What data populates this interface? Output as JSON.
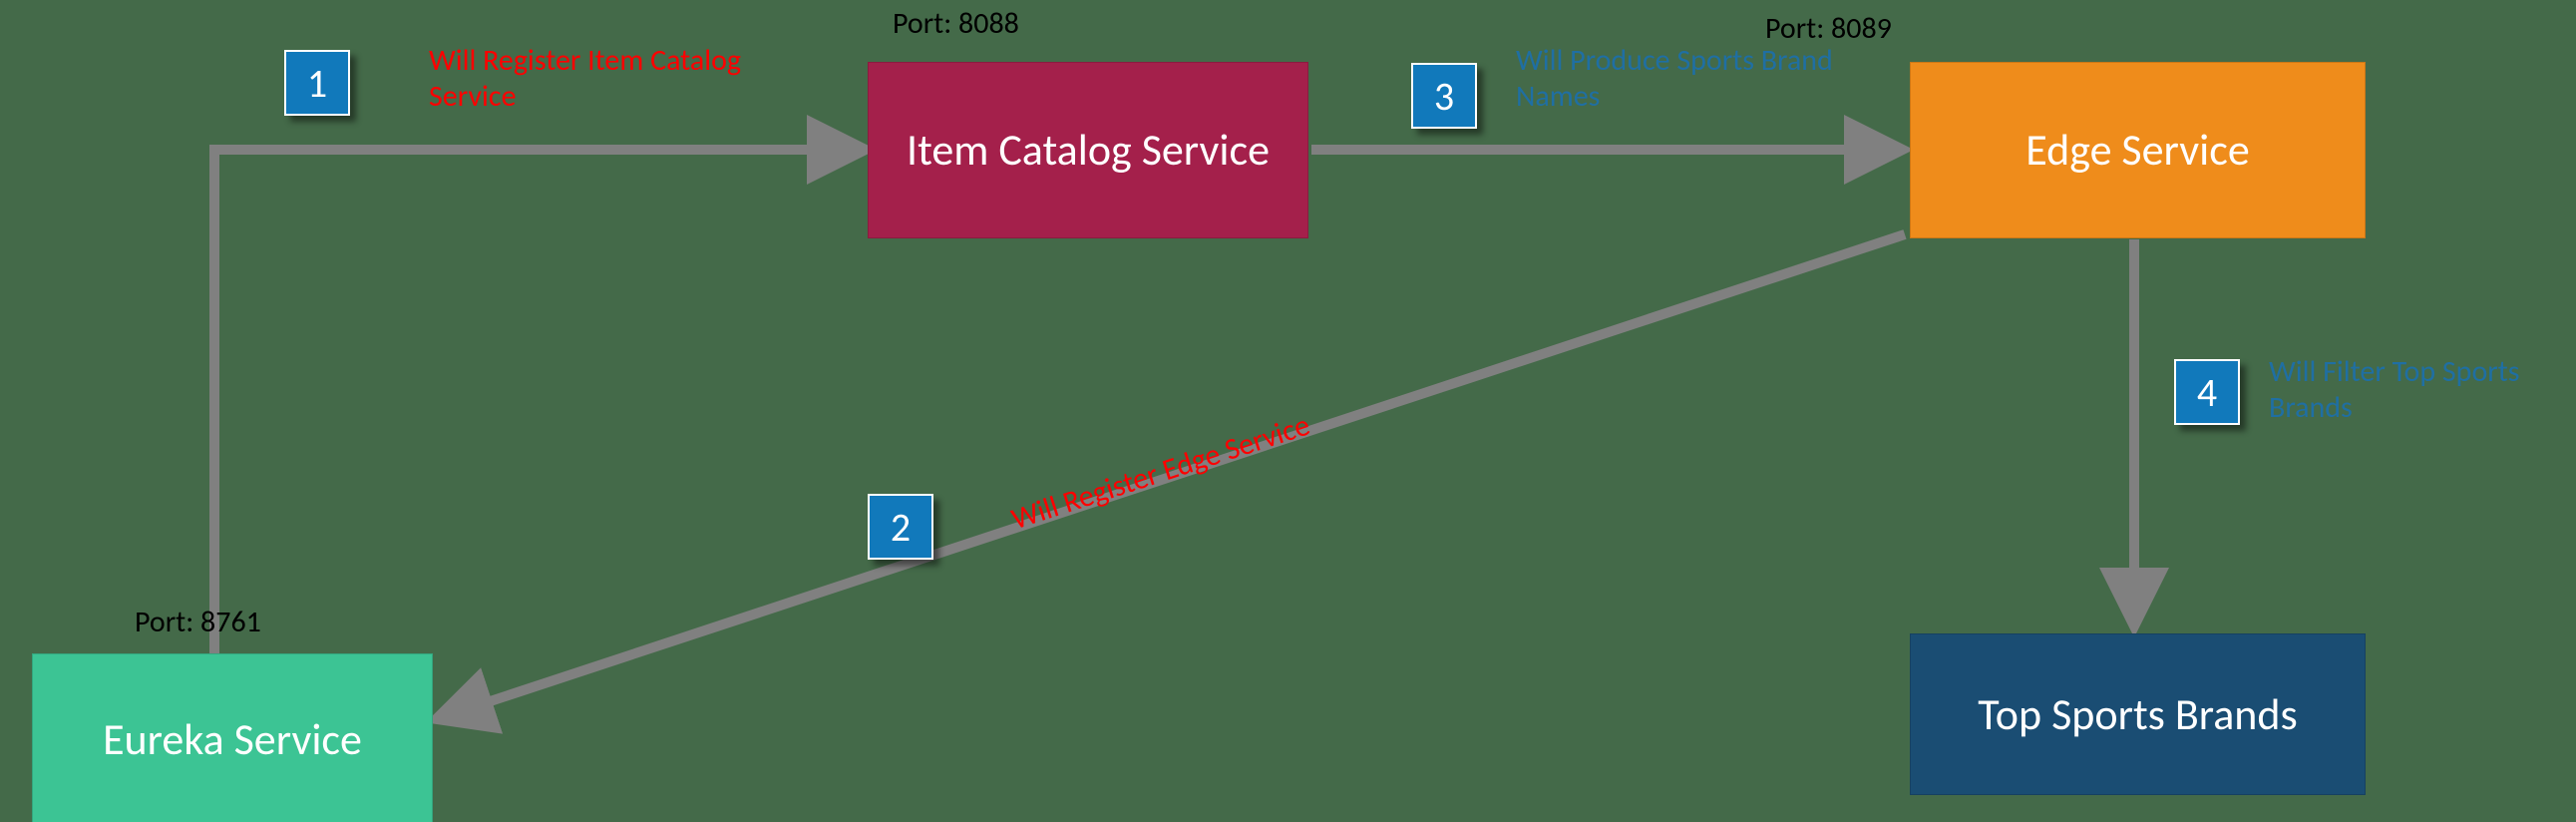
{
  "services": {
    "eureka": {
      "label": "Eureka Service",
      "port_label": "Port: 8761"
    },
    "itemCatalog": {
      "label": "Item Catalog Service",
      "port_label": "Port: 8088"
    },
    "edge": {
      "label": "Edge Service",
      "port_label": "Port: 8089"
    },
    "topSports": {
      "label": "Top Sports Brands"
    }
  },
  "steps": {
    "s1": {
      "num": "1",
      "text": "Will Register Item Catalog Service"
    },
    "s2": {
      "num": "2",
      "text": "Will Register Edge Service"
    },
    "s3": {
      "num": "3",
      "text": "Will Produce Sports Brand Names"
    },
    "s4": {
      "num": "4",
      "text": "Will Filter Top Sports Brands"
    }
  },
  "colors": {
    "eureka_bg": "#3cc494",
    "itemCatalog_bg": "#a4204b",
    "edge_bg": "#ef8c1b",
    "topSports_bg": "#1a4d73",
    "arrow": "#808080"
  }
}
